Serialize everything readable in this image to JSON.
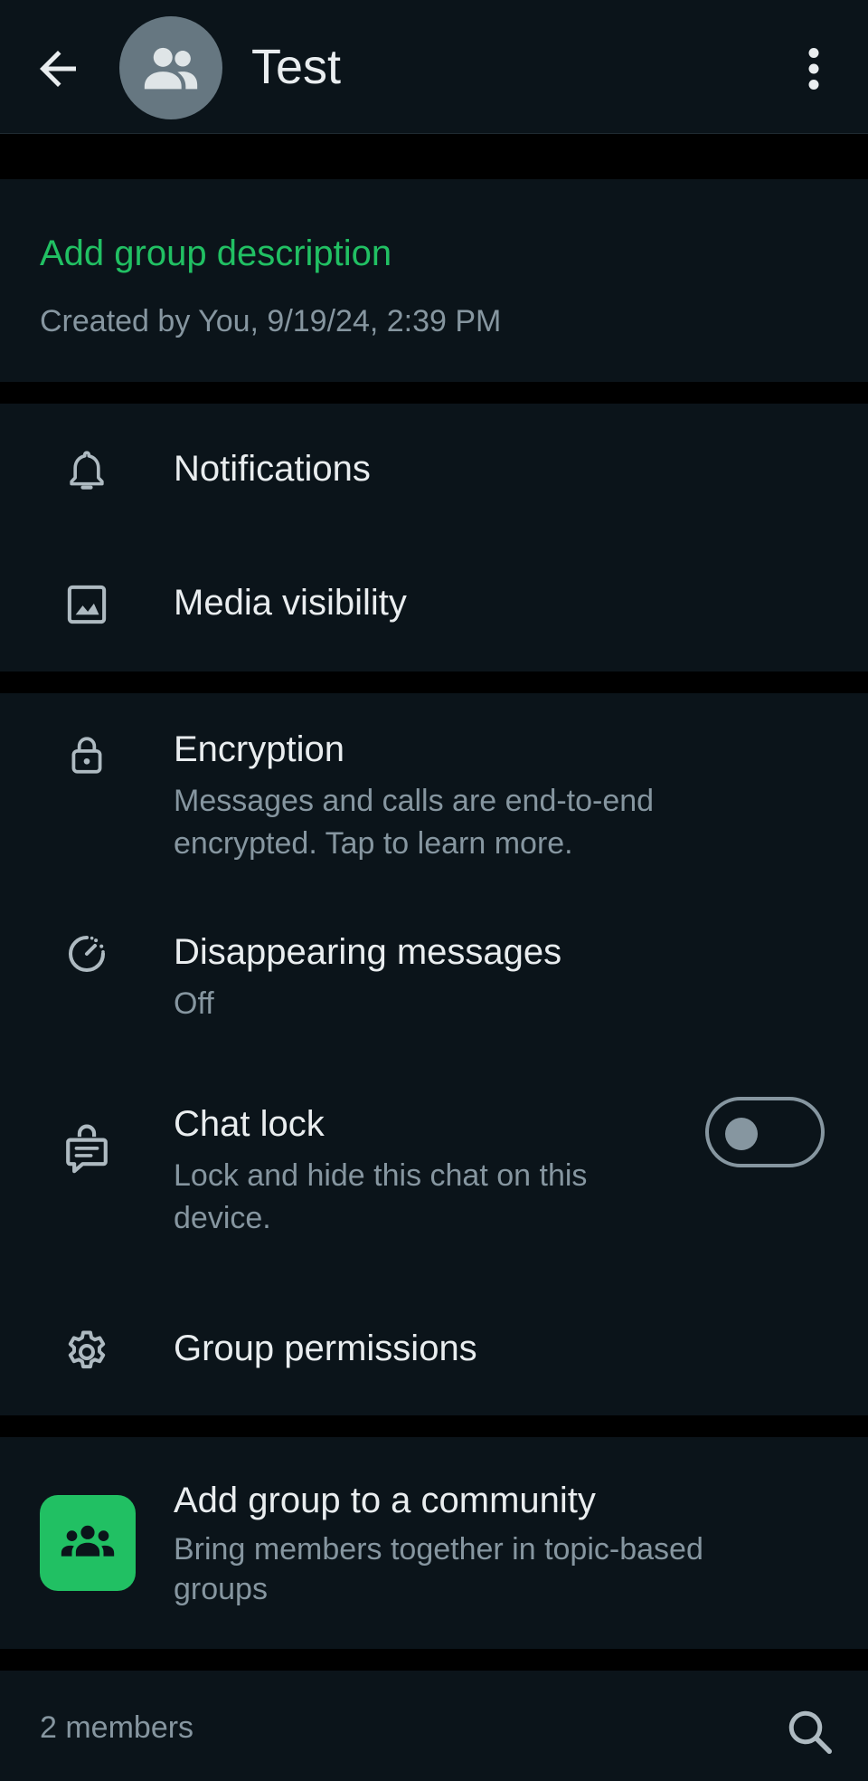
{
  "header": {
    "title": "Test",
    "back_icon": "arrow-left-icon",
    "avatar_icon": "group-icon",
    "more_icon": "more-vertical-icon"
  },
  "info": {
    "add_description": "Add group description",
    "created": "Created by You, 9/19/24, 2:39 PM"
  },
  "settings": {
    "notifications": {
      "label": "Notifications",
      "icon": "bell-icon"
    },
    "media_visibility": {
      "label": "Media visibility",
      "icon": "image-icon"
    }
  },
  "privacy": {
    "encryption": {
      "title": "Encryption",
      "subtitle": "Messages and calls are end-to-end encrypted. Tap to learn more.",
      "icon": "lock-icon"
    },
    "disappearing": {
      "title": "Disappearing messages",
      "subtitle": "Off",
      "icon": "timer-icon"
    },
    "chat_lock": {
      "title": "Chat lock",
      "subtitle": "Lock and hide this chat on this device.",
      "icon": "chat-lock-icon",
      "enabled": false
    },
    "permissions": {
      "title": "Group permissions",
      "icon": "gear-icon"
    }
  },
  "community": {
    "title": "Add group to a community",
    "subtitle": "Bring members together in topic-based groups",
    "icon": "community-icon"
  },
  "members": {
    "count_label": "2 members",
    "search_icon": "search-icon"
  },
  "colors": {
    "accent": "#21c063",
    "background": "#0b141a",
    "separator": "#000000",
    "secondary_text": "#8696a0"
  }
}
